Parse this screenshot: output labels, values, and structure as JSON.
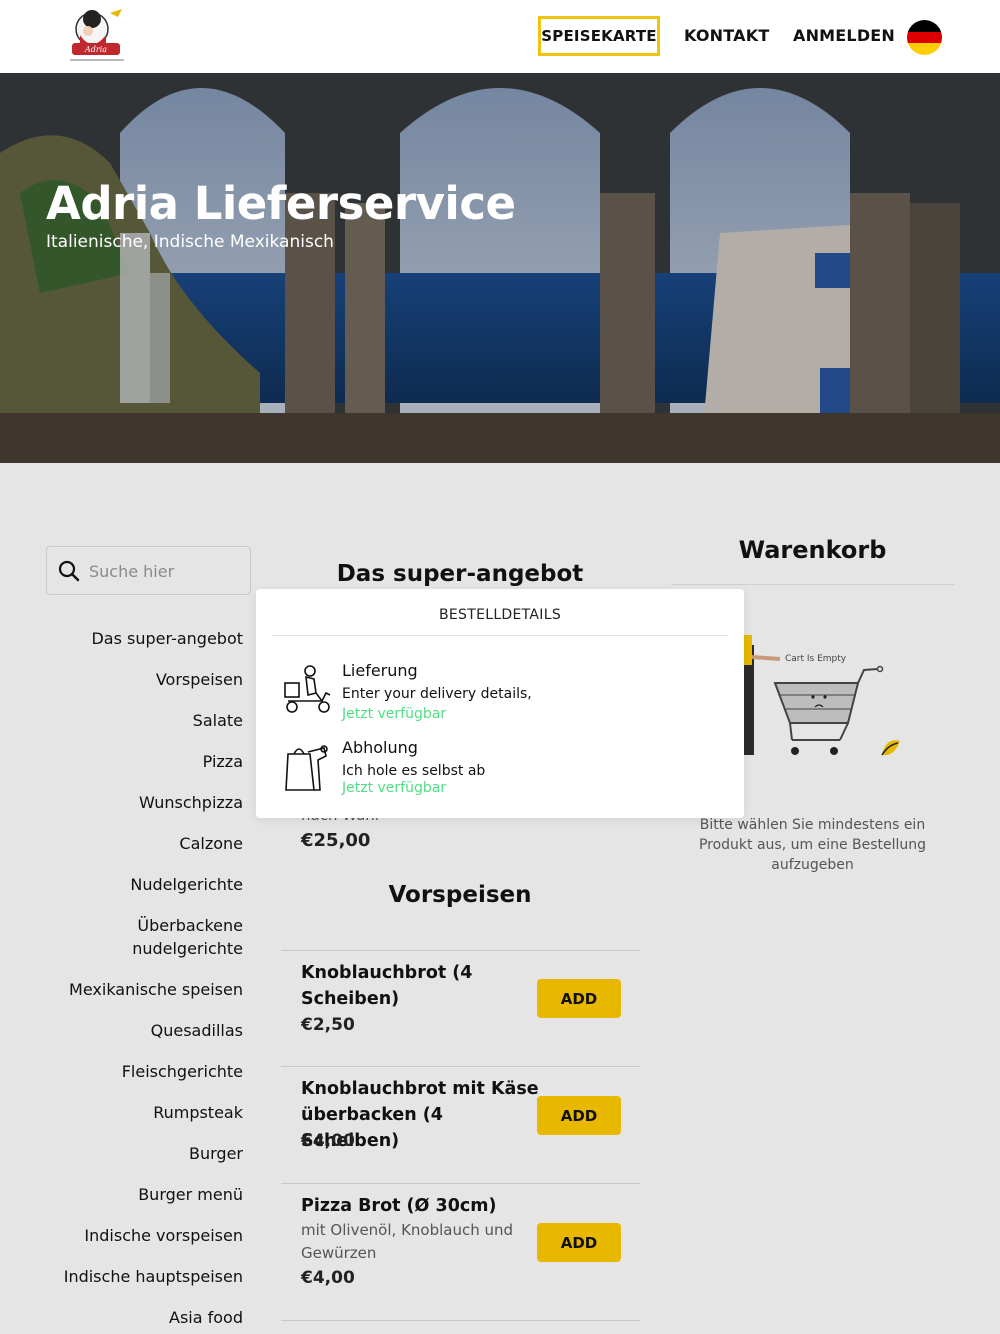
{
  "header": {
    "nav": {
      "speisekarte": "SPEISEKARTE",
      "kontakt": "KONTAKT",
      "anmelden": "ANMELDEN"
    },
    "language_flag": "flag-germany-icon"
  },
  "hero": {
    "title": "Adria Lieferservice",
    "subtitle": "Italienische, Indische Mexikanisch"
  },
  "search": {
    "placeholder": "Suche hier"
  },
  "categories": [
    "Das super-angebot",
    "Vorspeisen",
    "Salate",
    "Pizza",
    "Wunschpizza",
    "Calzone",
    "Nudelgerichte",
    "Überbackene nudelgerichte",
    "Mexikanische speisen",
    "Quesadillas",
    "Fleischgerichte",
    "Rumpsteak",
    "Burger",
    "Burger menü",
    "Indische vorspeisen",
    "Indische hauptspeisen",
    "Asia food"
  ],
  "menu": {
    "section_super": "Das super-angebot",
    "partial_item": {
      "desc_tail": "nach Wahl",
      "price": "€25,00"
    },
    "section_vorspeisen": "Vorspeisen",
    "add_label": "ADD",
    "items": [
      {
        "name": "Knoblauchbrot (4 Scheiben)",
        "desc": "",
        "price": "€2,50"
      },
      {
        "name": "Knoblauchbrot mit Käse überbacken (4 Scheiben)",
        "desc": "",
        "price": "€4,00"
      },
      {
        "name": "Pizza Brot (Ø 30cm)",
        "desc": "mit Olivenöl, Knoblauch und Gewürzen",
        "price": "€4,00"
      }
    ]
  },
  "cart": {
    "title": "Warenkorb",
    "empty_label": "Cart Is Empty",
    "hint": "Bitte wählen Sie mindestens ein Produkt aus, um eine Bestellung aufzugeben"
  },
  "modal": {
    "title": "BESTELLDETAILS",
    "options": [
      {
        "title": "Lieferung",
        "desc": "Enter your delivery details,",
        "status": "Jetzt verfügbar",
        "icon": "delivery-scooter-icon"
      },
      {
        "title": "Abholung",
        "desc": "Ich hole es selbst ab",
        "status": "Jetzt verfügbar",
        "icon": "pickup-bag-icon"
      }
    ]
  },
  "colors": {
    "accent": "#e8b800",
    "nav_border": "#f0c40a",
    "available": "#4ee083",
    "background": "#e5e5e5"
  }
}
